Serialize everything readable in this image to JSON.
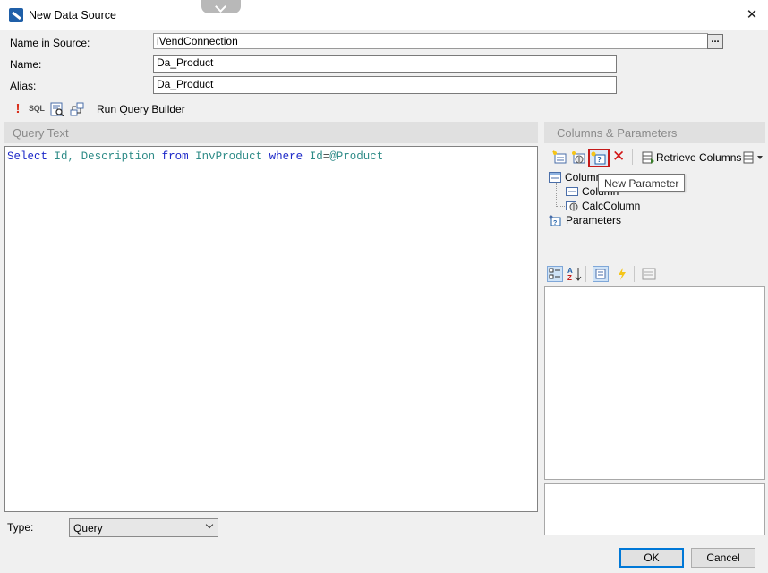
{
  "window": {
    "title": "New Data Source",
    "close_glyph": "✕"
  },
  "form": {
    "name_in_source_label": "Name in Source:",
    "name_in_source_value": "iVendConnection",
    "browse_label": "...",
    "name_label": "Name:",
    "name_value": "Da_Product",
    "alias_label": "Alias:",
    "alias_value": "Da_Product"
  },
  "query_toolbar": {
    "exclaim_glyph": "!",
    "sql_label": "SQL",
    "run_query_builder_label": "Run Query Builder"
  },
  "query_panel": {
    "header": "Query Text",
    "tokens": {
      "t1": "Select",
      "t2": "Id,",
      "t3": "Description",
      "t4": "from",
      "t5": "InvProduct",
      "t6": "where",
      "t7": "Id",
      "t8": "=",
      "t9": "@Product"
    }
  },
  "type_field": {
    "label": "Type:",
    "value": "Query"
  },
  "columns_panel": {
    "header": "Columns & Parameters",
    "retrieve_columns_label": "Retrieve Columns",
    "delete_glyph": "✕",
    "tooltip": "New Parameter",
    "tree": {
      "columns": "Columns",
      "column": "Column",
      "calc_column": "CalcColumn",
      "parameters": "Parameters"
    }
  },
  "buttons": {
    "ok": "OK",
    "cancel": "Cancel"
  },
  "colors": {
    "accent": "#0078d7",
    "highlight_border": "#c41a1a",
    "keyword": "#1c28c8",
    "identifier": "#2e8b87"
  }
}
